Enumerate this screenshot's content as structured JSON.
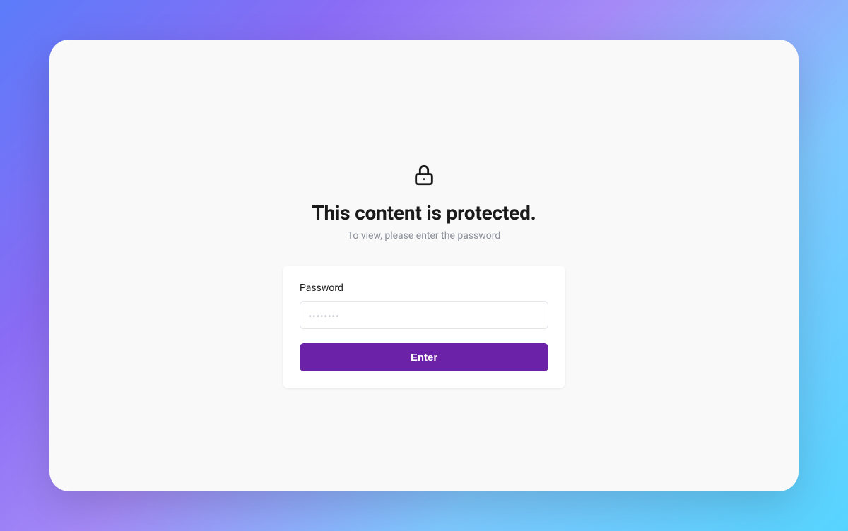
{
  "icon": "lock-icon",
  "heading": "This content is protected.",
  "subtitle": "To view, please enter the password",
  "form": {
    "password_label": "Password",
    "password_placeholder": "••••••••",
    "submit_label": "Enter"
  },
  "colors": {
    "accent": "#6b21a8",
    "card_bg": "#ffffff",
    "window_bg": "#f9f9fa"
  }
}
